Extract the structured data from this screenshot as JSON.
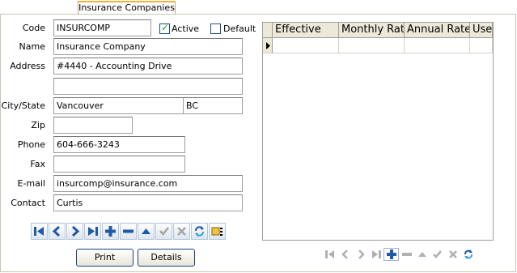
{
  "tab": {
    "label": "Insurance Companies"
  },
  "form": {
    "code_label": "Code",
    "code_value": "INSURCOMP",
    "active_label": "Active",
    "active_checked": true,
    "default_label": "Default",
    "default_checked": false,
    "name_label": "Name",
    "name_value": "Insurance Company",
    "address_label": "Address",
    "address1_value": "#4440 - Accounting Drive",
    "address2_value": "",
    "citystate_label": "City/State",
    "city_value": "Vancouver",
    "state_value": "BC",
    "zip_label": "Zip",
    "zip_value": "",
    "phone_label": "Phone",
    "phone_value": "604-666-3243",
    "fax_label": "Fax",
    "fax_value": "",
    "email_label": "E-mail",
    "email_value": "insurcomp@insurance.com",
    "contact_label": "Contact",
    "contact_value": "Curtis"
  },
  "nav_icons": [
    "first-icon",
    "prev-icon",
    "next-icon",
    "last-icon",
    "add-icon",
    "delete-icon",
    "up-icon",
    "confirm-icon",
    "cancel-icon",
    "refresh-icon",
    "search-icon"
  ],
  "buttons": {
    "print": "Print",
    "details": "Details"
  },
  "grid": {
    "columns": [
      "Effective",
      "Monthly Rate",
      "Annual Rate",
      "Use"
    ],
    "rows": [
      [
        "",
        "",
        "",
        ""
      ]
    ]
  },
  "colors": {
    "nav_blue": "#1f5aa6",
    "tab_accent": "#f0b43c",
    "check_green": "#21a121",
    "header_bg": "#ece9d8"
  }
}
